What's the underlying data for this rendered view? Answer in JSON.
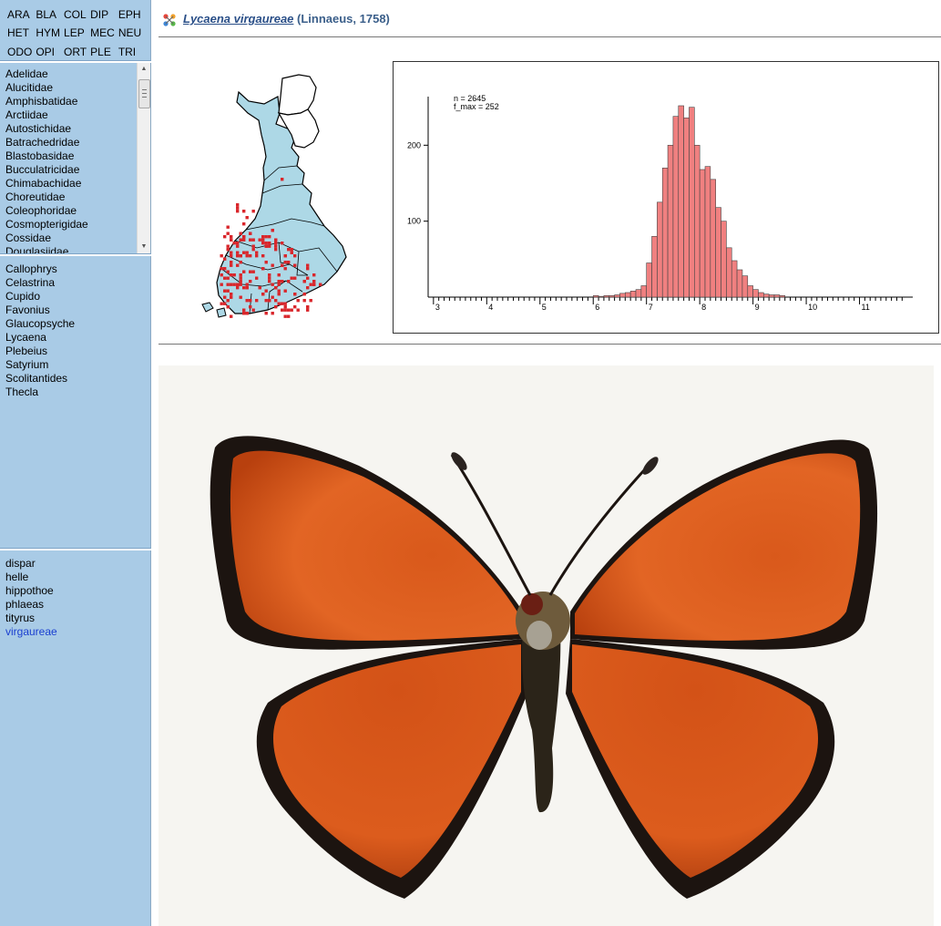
{
  "order_codes": [
    "ARA",
    "BLA",
    "COL",
    "DIP",
    "EPH",
    "HET",
    "HYM",
    "LEP",
    "MEC",
    "NEU",
    "ODO",
    "OPI",
    "ORT",
    "PLE",
    "TRI"
  ],
  "families": [
    "Adelidae",
    "Alucitidae",
    "Amphisbatidae",
    "Arctiidae",
    "Autostichidae",
    "Batrachedridae",
    "Blastobasidae",
    "Bucculatricidae",
    "Chimabachidae",
    "Choreutidae",
    "Coleophoridae",
    "Cosmopterigidae",
    "Cossidae",
    "Douglasiidae"
  ],
  "genera": [
    "Callophrys",
    "Celastrina",
    "Cupido",
    "Favonius",
    "Glaucopsyche",
    "Lycaena",
    "Plebeius",
    "Satyrium",
    "Scolitantides",
    "Thecla"
  ],
  "species": [
    "dispar",
    "helle",
    "hippothoe",
    "phlaeas",
    "tityrus",
    "virgaureae"
  ],
  "selected_species": "virgaureae",
  "header": {
    "title_link": "Lycaena virgaureae",
    "title_rest": " (Linnaeus, 1758)"
  },
  "colors": {
    "sidebar_bg": "#a9cbe6",
    "map_fill": "#add8e6",
    "map_points": "#d9262b",
    "bar_fill": "#f08080",
    "selected_text": "#1a3fd0"
  },
  "chart_data": {
    "type": "bar",
    "stats": [
      "n = 2645",
      "f_max = 252"
    ],
    "xlim": [
      2.9,
      12.0
    ],
    "ylim": [
      0,
      300
    ],
    "xticks": [
      3,
      4,
      5,
      6,
      7,
      8,
      9,
      10,
      11
    ],
    "yticks": [
      100,
      200
    ],
    "bin_width": 0.1,
    "bins": [
      [
        6.0,
        2
      ],
      [
        6.1,
        1
      ],
      [
        6.2,
        2
      ],
      [
        6.3,
        2
      ],
      [
        6.4,
        3
      ],
      [
        6.5,
        5
      ],
      [
        6.6,
        6
      ],
      [
        6.7,
        8
      ],
      [
        6.8,
        10
      ],
      [
        6.9,
        15
      ],
      [
        7.0,
        45
      ],
      [
        7.1,
        80
      ],
      [
        7.2,
        125
      ],
      [
        7.3,
        170
      ],
      [
        7.4,
        200
      ],
      [
        7.5,
        238
      ],
      [
        7.6,
        252
      ],
      [
        7.7,
        236
      ],
      [
        7.8,
        250
      ],
      [
        7.9,
        200
      ],
      [
        8.0,
        168
      ],
      [
        8.1,
        172
      ],
      [
        8.2,
        155
      ],
      [
        8.3,
        118
      ],
      [
        8.4,
        100
      ],
      [
        8.5,
        65
      ],
      [
        8.6,
        48
      ],
      [
        8.7,
        36
      ],
      [
        8.8,
        28
      ],
      [
        8.9,
        15
      ],
      [
        9.0,
        10
      ],
      [
        9.1,
        6
      ],
      [
        9.2,
        4
      ],
      [
        9.3,
        3
      ],
      [
        9.4,
        3
      ],
      [
        9.5,
        2
      ]
    ]
  }
}
